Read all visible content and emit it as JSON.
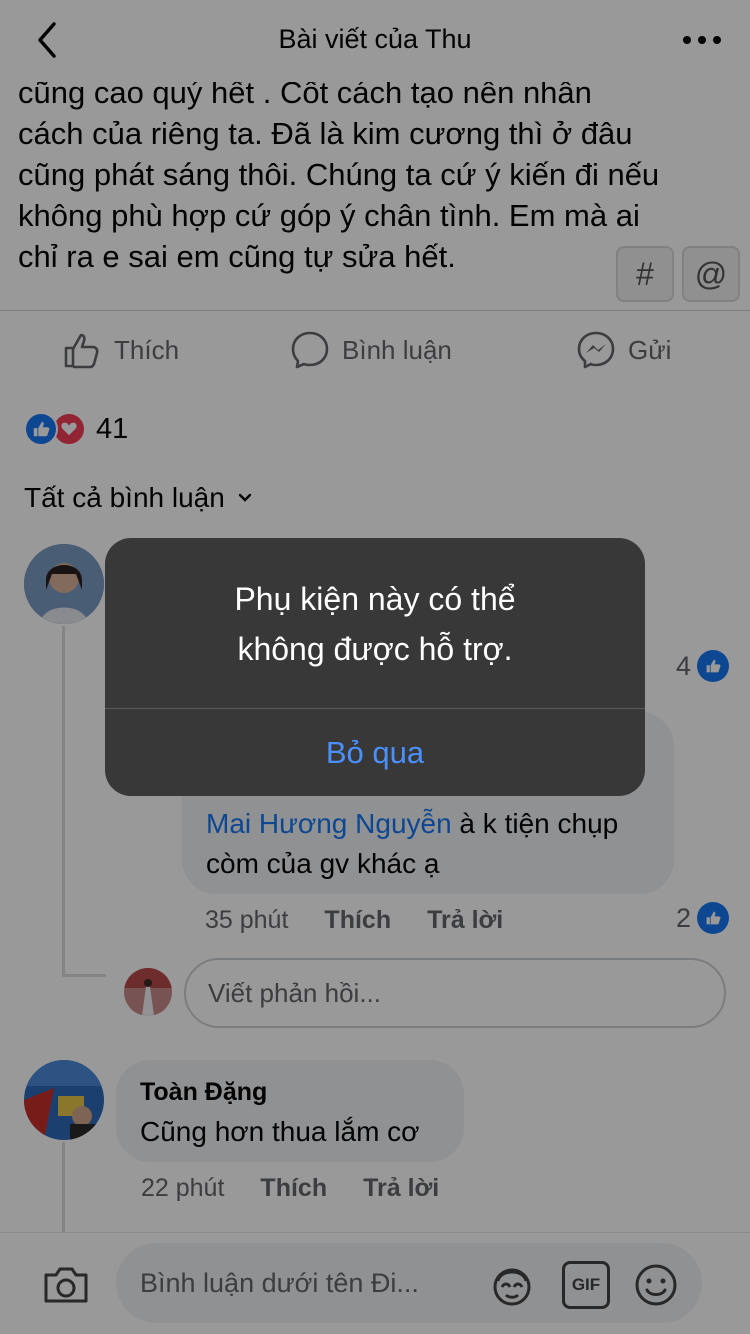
{
  "header": {
    "title": "Bài viết của Thu",
    "back_icon": "chevron-left-icon",
    "more_icon": "more-horizontal-icon"
  },
  "post": {
    "text_partial": "cũng cao quý hết . Cốt cách tạo nên nhân\ncách của riêng ta. Đã là kim cương thì ở đâu\ncũng phát sáng thôi. Chúng ta cứ ý kiến đi nếu\nkhông phù hợp cứ góp ý chân tình. Em mà ai\nchỉ ra e sai em cũng tự sửa hết.",
    "hashtag_label": "#",
    "mention_label": "@"
  },
  "actions": {
    "like_label": "Thích",
    "comment_label": "Bình luận",
    "send_label": "Gửi"
  },
  "reactions": {
    "count": "41"
  },
  "comments_filter": {
    "label": "Tất cả bình luận"
  },
  "comment1": {
    "like_count": "4"
  },
  "reply1": {
    "mention": "Mai Hương Nguyễn",
    "text_after_mention": " à k tiện chụp",
    "text_line2": "còm của gv khác ạ",
    "time": "35 phút",
    "like_label": "Thích",
    "reply_label": "Trả lời",
    "like_count": "2"
  },
  "reply_box": {
    "placeholder": "Viết phản hồi..."
  },
  "comment2": {
    "author": "Toàn Đặng",
    "text": "Cũng hơn thua lắm cơ",
    "time": "22 phút",
    "like_label": "Thích",
    "reply_label": "Trả lời"
  },
  "bottom_bar": {
    "placeholder": "Bình luận dưới tên Đi...",
    "gif_label": "GIF"
  },
  "alert": {
    "message": "Phụ kiện này có thể\nkhông được hỗ trợ.",
    "dismiss_label": "Bỏ qua"
  },
  "colors": {
    "accent": "#1877f2",
    "love": "#f33e58",
    "alert_bg": "#343434",
    "alert_button": "#4a90ff"
  }
}
